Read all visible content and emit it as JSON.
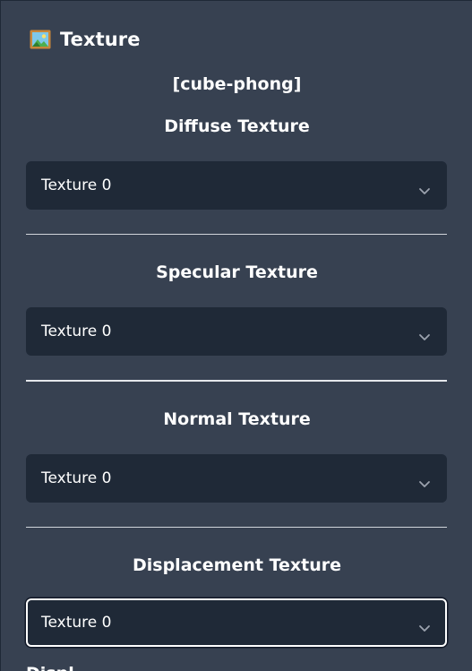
{
  "header": {
    "icon": "framed-picture-icon",
    "title": "Texture"
  },
  "material_name": "[cube-phong]",
  "sections": [
    {
      "title": "Diffuse Texture",
      "selected": "Texture 0"
    },
    {
      "title": "Specular Texture",
      "selected": "Texture 0"
    },
    {
      "title": "Normal Texture",
      "selected": "Texture 0"
    },
    {
      "title": "Displacement Texture",
      "selected": "Texture 0"
    }
  ],
  "cutoff_label": "Displ",
  "colors": {
    "panel_bg": "#374151",
    "select_bg": "#1f2937",
    "text": "#ffffff",
    "divider": "#d1d5db"
  }
}
